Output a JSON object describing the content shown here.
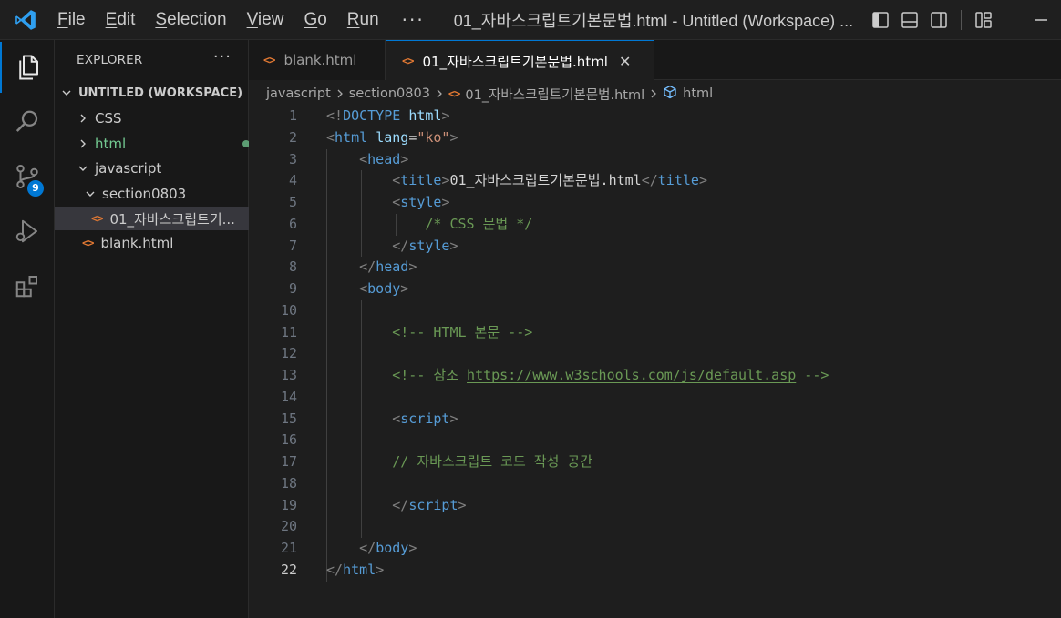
{
  "window": {
    "title": "01_자바스크립트기본문법.html - Untitled (Workspace) ...",
    "menu": [
      {
        "id": "file",
        "first": "F",
        "rest": "ile"
      },
      {
        "id": "edit",
        "first": "E",
        "rest": "dit"
      },
      {
        "id": "selection",
        "first": "S",
        "rest": "election"
      },
      {
        "id": "view",
        "first": "V",
        "rest": "iew"
      },
      {
        "id": "go",
        "first": "G",
        "rest": "o"
      },
      {
        "id": "run",
        "first": "R",
        "rest": "un"
      }
    ],
    "more": "···"
  },
  "activity_bar": {
    "items": [
      "files-icon",
      "search-icon",
      "source-control-icon",
      "run-debug-icon",
      "extensions-icon"
    ],
    "scm_badge": "9"
  },
  "sidebar": {
    "header": "EXPLORER",
    "more": "···",
    "workspace": "UNTITLED (WORKSPACE)",
    "tree": [
      {
        "label": "CSS",
        "kind": "folder",
        "open": false
      },
      {
        "label": "html",
        "kind": "folder",
        "open": false,
        "modified": true
      },
      {
        "label": "javascript",
        "kind": "folder",
        "open": true
      },
      {
        "label": "section0803",
        "kind": "folder",
        "open": true
      },
      {
        "label": "01_자바스크립트기...",
        "kind": "file",
        "selected": true
      },
      {
        "label": "blank.html",
        "kind": "file"
      }
    ],
    "file_glyph": "<>"
  },
  "tabs": [
    {
      "label": "blank.html",
      "active": false
    },
    {
      "label": "01_자바스크립트기본문법.html",
      "active": true,
      "close": "✕"
    }
  ],
  "breadcrumb": [
    "javascript",
    "section0803",
    "01_자바스크립트기본문법.html",
    "html"
  ],
  "editor": {
    "active_line": 22,
    "lines": [
      {
        "n": "1",
        "t": [
          [
            "br",
            "<!"
          ],
          [
            "doc",
            "DOCTYPE"
          ],
          [
            "txt",
            " "
          ],
          [
            "attr",
            "html"
          ],
          [
            "br",
            ">"
          ]
        ]
      },
      {
        "n": "2",
        "t": [
          [
            "br",
            "<"
          ],
          [
            "tag",
            "html"
          ],
          [
            "txt",
            " "
          ],
          [
            "attr",
            "lang"
          ],
          [
            "txt",
            "="
          ],
          [
            "str",
            "\"ko\""
          ],
          [
            "br",
            ">"
          ]
        ]
      },
      {
        "n": "3",
        "t": [
          [
            "txt",
            "    "
          ],
          [
            "br",
            "<"
          ],
          [
            "tag",
            "head"
          ],
          [
            "br",
            ">"
          ]
        ]
      },
      {
        "n": "4",
        "t": [
          [
            "txt",
            "        "
          ],
          [
            "br",
            "<"
          ],
          [
            "tag",
            "title"
          ],
          [
            "br",
            ">"
          ],
          [
            "txt",
            "01_자바스크립트기본문법.html"
          ],
          [
            "br",
            "</"
          ],
          [
            "tag",
            "title"
          ],
          [
            "br",
            ">"
          ]
        ]
      },
      {
        "n": "5",
        "t": [
          [
            "txt",
            "        "
          ],
          [
            "br",
            "<"
          ],
          [
            "tag",
            "style"
          ],
          [
            "br",
            ">"
          ]
        ]
      },
      {
        "n": "6",
        "t": [
          [
            "txt",
            "            "
          ],
          [
            "cmt",
            "/* CSS 문법 */"
          ]
        ]
      },
      {
        "n": "7",
        "t": [
          [
            "txt",
            "        "
          ],
          [
            "br",
            "</"
          ],
          [
            "tag",
            "style"
          ],
          [
            "br",
            ">"
          ]
        ]
      },
      {
        "n": "8",
        "t": [
          [
            "txt",
            "    "
          ],
          [
            "br",
            "</"
          ],
          [
            "tag",
            "head"
          ],
          [
            "br",
            ">"
          ]
        ]
      },
      {
        "n": "9",
        "t": [
          [
            "txt",
            "    "
          ],
          [
            "br",
            "<"
          ],
          [
            "tag",
            "body"
          ],
          [
            "br",
            ">"
          ]
        ]
      },
      {
        "n": "10",
        "t": []
      },
      {
        "n": "11",
        "t": [
          [
            "txt",
            "        "
          ],
          [
            "cmt",
            "<!-- HTML 본문 -->"
          ]
        ]
      },
      {
        "n": "12",
        "t": []
      },
      {
        "n": "13",
        "t": [
          [
            "txt",
            "        "
          ],
          [
            "cmt",
            "<!-- 참조 "
          ],
          [
            "link",
            "https://www.w3schools.com/js/default.asp"
          ],
          [
            "cmt",
            " -->"
          ]
        ]
      },
      {
        "n": "14",
        "t": []
      },
      {
        "n": "15",
        "t": [
          [
            "txt",
            "        "
          ],
          [
            "br",
            "<"
          ],
          [
            "tag",
            "script"
          ],
          [
            "br",
            ">"
          ]
        ]
      },
      {
        "n": "16",
        "t": []
      },
      {
        "n": "17",
        "t": [
          [
            "txt",
            "        "
          ],
          [
            "cmt",
            "// 자바스크립트 코드 작성 공간"
          ]
        ]
      },
      {
        "n": "18",
        "t": []
      },
      {
        "n": "19",
        "t": [
          [
            "txt",
            "        "
          ],
          [
            "br",
            "</"
          ],
          [
            "tag",
            "script"
          ],
          [
            "br",
            ">"
          ]
        ]
      },
      {
        "n": "20",
        "t": []
      },
      {
        "n": "21",
        "t": [
          [
            "txt",
            "    "
          ],
          [
            "br",
            "</"
          ],
          [
            "tag",
            "body"
          ],
          [
            "br",
            ">"
          ]
        ]
      },
      {
        "n": "22",
        "t": [
          [
            "br",
            "</"
          ],
          [
            "tag",
            "html"
          ],
          [
            "br",
            ">"
          ]
        ]
      }
    ]
  },
  "colors": {
    "accent": "#0078d4",
    "file_icon": "#e37933",
    "modified": "#73c991"
  }
}
